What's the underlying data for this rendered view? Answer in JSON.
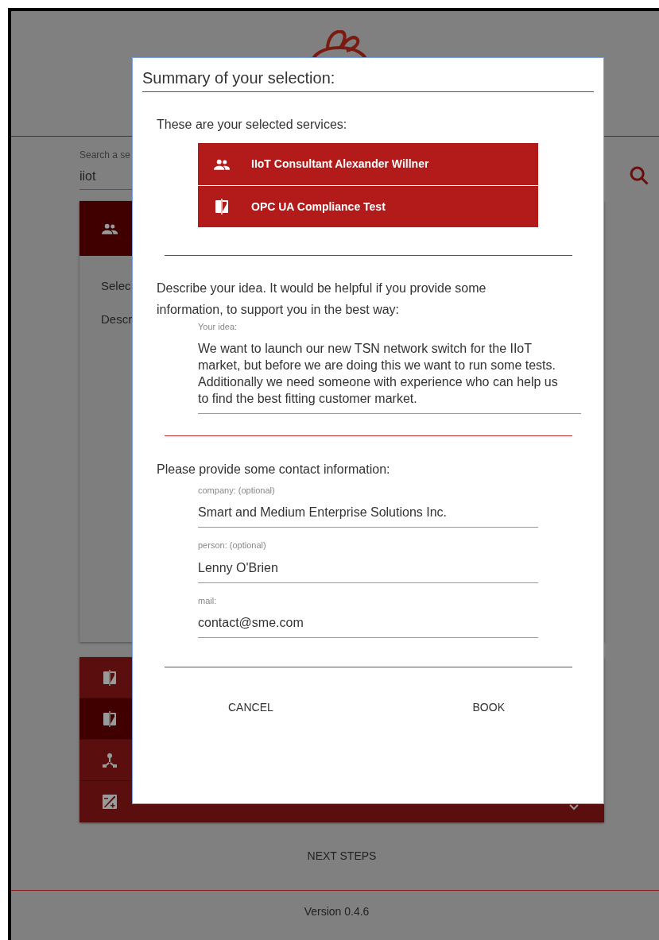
{
  "page": {
    "search": {
      "label": "Search a se",
      "value": "iiot"
    },
    "card": {
      "lines": [
        "Selec",
        "Descr"
      ]
    },
    "service_list": [
      {
        "kind": "compare",
        "selected": false
      },
      {
        "kind": "compare",
        "selected": true
      },
      {
        "kind": "hub",
        "selected": false
      },
      {
        "kind": "exposure",
        "selected": false,
        "expanded": false
      }
    ],
    "next_steps": "NEXT STEPS",
    "version": "Version 0.4.6"
  },
  "dialog": {
    "title": "Summary of your selection:",
    "services_heading": "These are your selected services:",
    "services": [
      {
        "kind": "people",
        "label": "IIoT Consultant Alexander Willner"
      },
      {
        "kind": "compare",
        "label": "OPC UA Compliance Test"
      }
    ],
    "idea_prompt": "Describe your idea. It would be helpful if you provide some information, to support you in the best way:",
    "idea_field": {
      "label": "Your idea:",
      "value": "We want to launch our new TSN network switch for the IIoT market, but before we are doing this we want to run some tests. Additionally we need someone with experience who can help us to find the best fitting customer market."
    },
    "contact_prompt": "Please provide some contact information:",
    "contact_fields": [
      {
        "label": "company: (optional)",
        "value": "Smart and Medium Enterprise Solutions Inc."
      },
      {
        "label": "person: (optional)",
        "value": "Lenny O'Brien"
      },
      {
        "label": "mail:",
        "value": "contact@sme.com"
      }
    ],
    "buttons": [
      "CANCEL",
      "BOOK"
    ]
  }
}
